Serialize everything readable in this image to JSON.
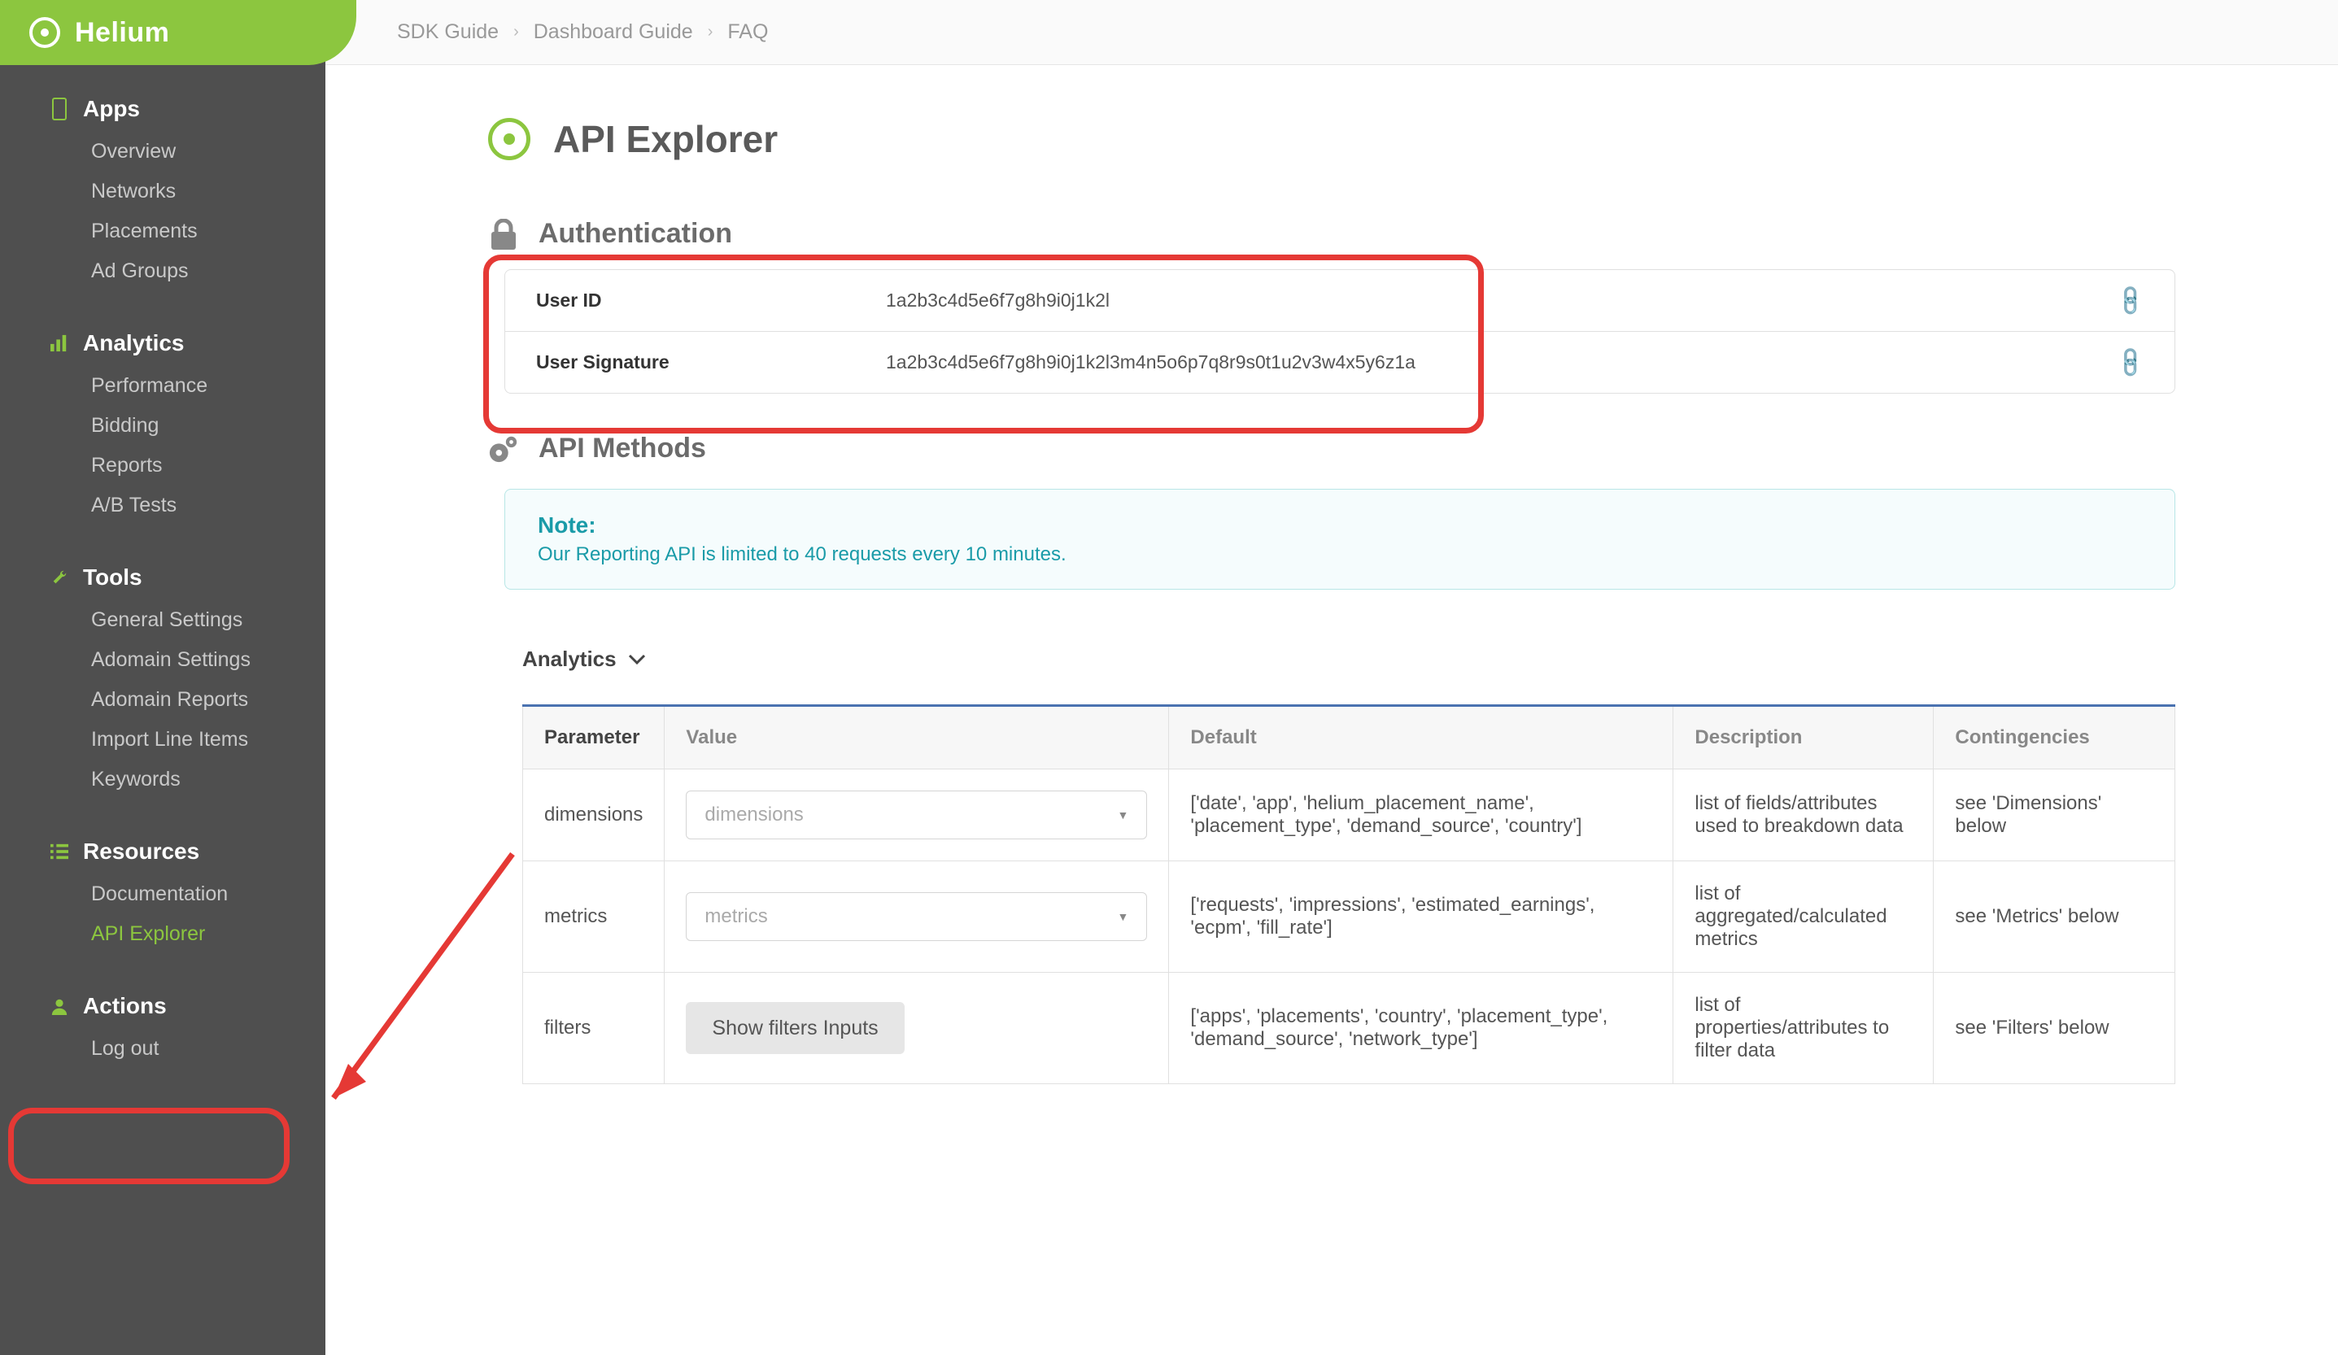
{
  "brand": "Helium",
  "topnav": {
    "sdk": "SDK Guide",
    "dash": "Dashboard Guide",
    "faq": "FAQ"
  },
  "sidebar": {
    "apps": {
      "head": "Apps",
      "items": [
        "Overview",
        "Networks",
        "Placements",
        "Ad Groups"
      ]
    },
    "analytics": {
      "head": "Analytics",
      "items": [
        "Performance",
        "Bidding",
        "Reports",
        "A/B Tests"
      ]
    },
    "tools": {
      "head": "Tools",
      "items": [
        "General Settings",
        "Adomain Settings",
        "Adomain Reports",
        "Import Line Items",
        "Keywords"
      ]
    },
    "resources": {
      "head": "Resources",
      "items": [
        "Documentation",
        "API Explorer"
      ]
    },
    "actions": {
      "head": "Actions",
      "items": [
        "Log out"
      ]
    }
  },
  "page": {
    "title": "API Explorer",
    "auth_title": "Authentication",
    "methods_title": "API Methods",
    "auth_rows": {
      "uid_k": "User ID",
      "uid_v": "1a2b3c4d5e6f7g8h9i0j1k2l",
      "sig_k": "User Signature",
      "sig_v": "1a2b3c4d5e6f7g8h9i0j1k2l3m4n5o6p7q8r9s0t1u2v3w4x5y6z1a"
    },
    "note_title": "Note:",
    "note_text": "Our Reporting API is limited to 40 requests every 10 minutes.",
    "expander": "Analytics",
    "table": {
      "headers": {
        "p": "Parameter",
        "v": "Value",
        "d": "Default",
        "desc": "Description",
        "c": "Contingencies"
      },
      "rows": {
        "r0": {
          "p": "dimensions",
          "vph": "dimensions",
          "d": "['date', 'app', 'helium_placement_name', 'placement_type', 'demand_source', 'country']",
          "desc": "list of fields/attributes used to breakdown data",
          "c": "see 'Dimensions' below"
        },
        "r1": {
          "p": "metrics",
          "vph": "metrics",
          "d": "['requests', 'impressions', 'estimated_earnings', 'ecpm', 'fill_rate']",
          "desc": "list of aggregated/calculated metrics",
          "c": "see 'Metrics' below"
        },
        "r2": {
          "p": "filters",
          "btn": "Show filters Inputs",
          "d": "['apps', 'placements', 'country', 'placement_type', 'demand_source', 'network_type']",
          "desc": "list of properties/attributes to filter data",
          "c": "see 'Filters' below"
        }
      }
    }
  }
}
